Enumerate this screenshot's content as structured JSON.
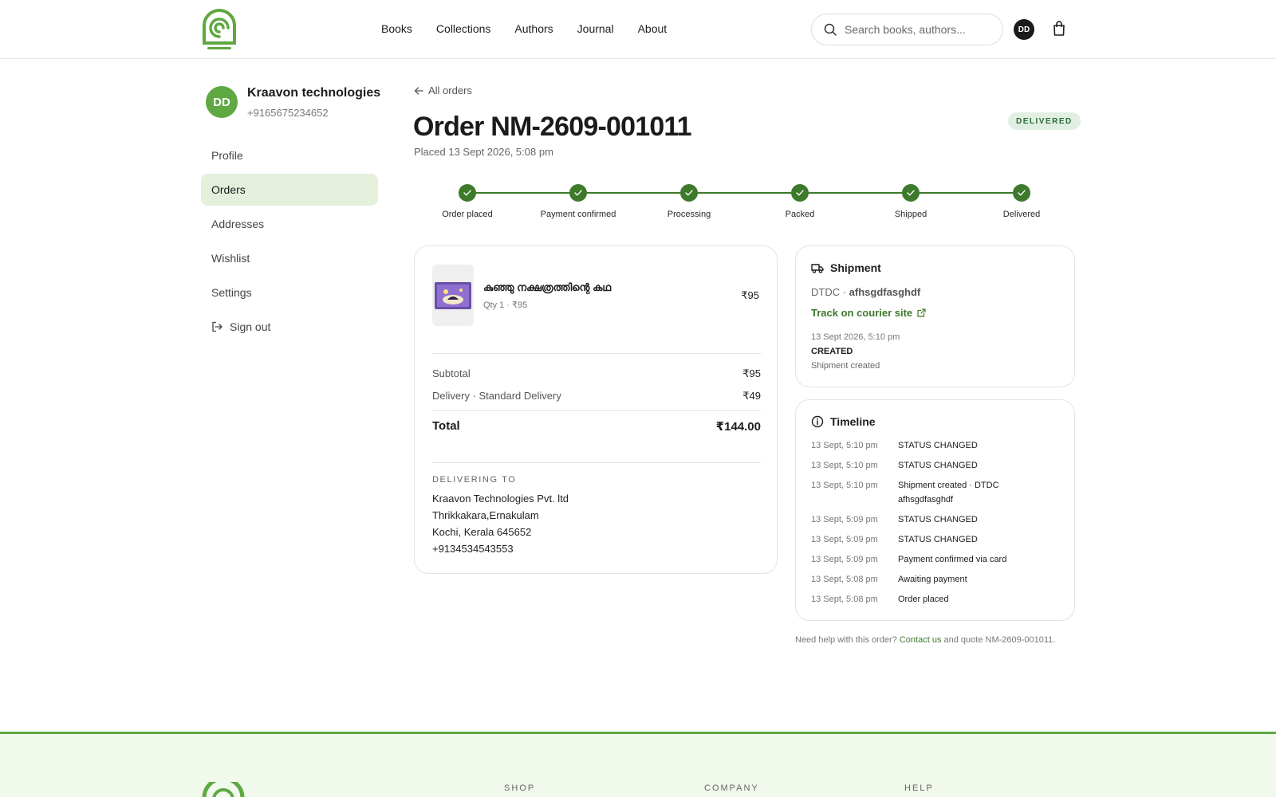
{
  "header": {
    "nav": [
      "Books",
      "Collections",
      "Authors",
      "Journal",
      "About"
    ],
    "search_placeholder": "Search books, authors...",
    "avatar_initials": "DD"
  },
  "user": {
    "initials": "DD",
    "name": "Kraavon technologies",
    "phone": "+9165675234652"
  },
  "sidebar": {
    "items": [
      {
        "label": "Profile"
      },
      {
        "label": "Orders"
      },
      {
        "label": "Addresses"
      },
      {
        "label": "Wishlist"
      },
      {
        "label": "Settings"
      },
      {
        "label": "Sign out"
      }
    ],
    "active": "Orders"
  },
  "order": {
    "back_label": "All orders",
    "title": "Order NM-2609-001011",
    "placed": "Placed 13 Sept 2026, 5:08 pm",
    "status": "DELIVERED",
    "steps": [
      "Order placed",
      "Payment confirmed",
      "Processing",
      "Packed",
      "Shipped",
      "Delivered"
    ],
    "item": {
      "title": "കുഞ്ഞു നക്ഷത്രത്തിന്റെ കഥ",
      "meta": "Qty 1 · ₹95",
      "price": "₹95"
    },
    "subtotal_label": "Subtotal",
    "subtotal": "₹95",
    "delivery_label": "Delivery · Standard Delivery",
    "delivery": "₹49",
    "total_label": "Total",
    "total": "₹144.00",
    "delivering_to_label": "DELIVERING TO",
    "address": {
      "line1": "Kraavon Technologies Pvt. ltd",
      "line2": "Thrikkakara,Ernakulam",
      "line3": "Kochi, Kerala 645652",
      "phone": "+9134534543553"
    }
  },
  "shipment": {
    "title": "Shipment",
    "carrier": "DTDC",
    "tracking": "afhsgdfasghdf",
    "track_label": "Track on courier site",
    "event_time": "13 Sept 2026, 5:10 pm",
    "event_status": "CREATED",
    "event_desc": "Shipment created"
  },
  "timeline": {
    "title": "Timeline",
    "events": [
      {
        "time": "13 Sept, 5:10 pm",
        "event": "STATUS CHANGED"
      },
      {
        "time": "13 Sept, 5:10 pm",
        "event": "STATUS CHANGED"
      },
      {
        "time": "13 Sept, 5:10 pm",
        "event": "Shipment created · DTDC afhsgdfasghdf"
      },
      {
        "time": "13 Sept, 5:09 pm",
        "event": "STATUS CHANGED"
      },
      {
        "time": "13 Sept, 5:09 pm",
        "event": "STATUS CHANGED"
      },
      {
        "time": "13 Sept, 5:09 pm",
        "event": "Payment confirmed via card"
      },
      {
        "time": "13 Sept, 5:08 pm",
        "event": "Awaiting payment"
      },
      {
        "time": "13 Sept, 5:08 pm",
        "event": "Order placed"
      }
    ]
  },
  "help": {
    "prefix": "Need help with this order?",
    "link": "Contact us",
    "suffix": "and quote NM-2609-001011."
  },
  "footer": {
    "columns": [
      "SHOP",
      "COMPANY",
      "HELP"
    ]
  },
  "colors": {
    "accent": "#3d7a2b",
    "brand": "#5fa842",
    "active_bg": "#e4efdc",
    "badge_bg": "#e0efe1"
  }
}
